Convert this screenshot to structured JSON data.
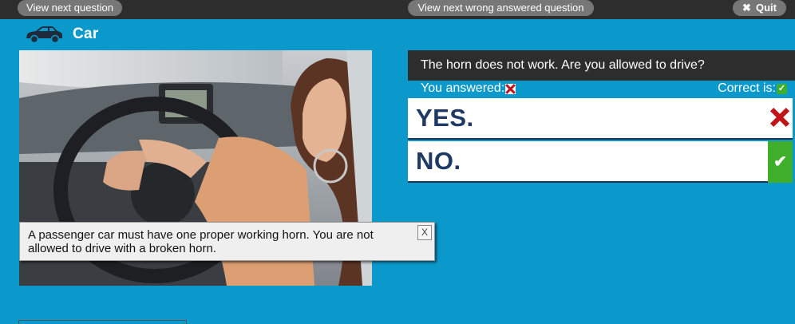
{
  "toolbar": {
    "next_question": "View next question",
    "next_wrong": "View next wrong answered question",
    "quit": "Quit",
    "quit_icon": "x-icon"
  },
  "category": {
    "icon": "car-icon",
    "label": "Car"
  },
  "photo": {
    "subject": "woman-driver-pressing-horn"
  },
  "explanation": {
    "text": "A passenger car must have one proper working horn. You are not allowed to drive with a broken horn.",
    "close": "X"
  },
  "question": {
    "text": "The horn does not work. Are you allowed to drive?"
  },
  "answer_status": {
    "you_answered": "You answered:",
    "correct_is": "Correct is:"
  },
  "options": [
    {
      "label": "YES.",
      "state": "wrong"
    },
    {
      "label": "NO.",
      "state": "correct"
    }
  ],
  "colors": {
    "background": "#0b99cc",
    "topbar": "#2d2d2d",
    "wrong": "#c0141b",
    "correct": "#3fae2a",
    "answer_text": "#1e3a64"
  }
}
